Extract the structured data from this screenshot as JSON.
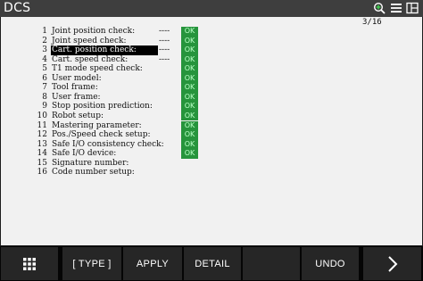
{
  "window": {
    "title": "DCS",
    "icons": [
      "zoom-icon",
      "menu-icon",
      "split-screen-icon"
    ]
  },
  "page_indicator": "3/16",
  "colors": {
    "ok_background": "#26943c",
    "ok_text": "#b9ffc6",
    "panel": "#f1f1f1",
    "titlebar": "#3e3e3e",
    "fkey": "#262626"
  },
  "rows": [
    {
      "num": "1",
      "label": "Joint position check:",
      "dashes": "----",
      "status": "OK",
      "selected": false
    },
    {
      "num": "2",
      "label": "Joint speed check:",
      "dashes": "----",
      "status": "OK",
      "selected": false
    },
    {
      "num": "3",
      "label": "Cart. position check:",
      "dashes": "----",
      "status": "OK",
      "selected": true
    },
    {
      "num": "4",
      "label": "Cart. speed check:",
      "dashes": "----",
      "status": "OK",
      "selected": false
    },
    {
      "num": "5",
      "label": "T1 mode speed check:",
      "dashes": "",
      "status": "OK",
      "selected": false
    },
    {
      "num": "6",
      "label": "User model:",
      "dashes": "",
      "status": "OK",
      "selected": false
    },
    {
      "num": "7",
      "label": "Tool frame:",
      "dashes": "",
      "status": "OK",
      "selected": false
    },
    {
      "num": "8",
      "label": "User frame:",
      "dashes": "",
      "status": "OK",
      "selected": false
    },
    {
      "num": "9",
      "label": "Stop position prediction:",
      "dashes": "",
      "status": "OK",
      "selected": false
    },
    {
      "num": "10",
      "label": "Robot setup:",
      "dashes": "",
      "status": "OK",
      "selected": false
    },
    {
      "num": "11",
      "label": "Mastering parameter:",
      "dashes": "",
      "status": "OK",
      "selected": false
    },
    {
      "num": "12",
      "label": "Pos./Speed check setup:",
      "dashes": "",
      "status": "OK",
      "selected": false
    },
    {
      "num": "13",
      "label": "Safe I/O consistency check:",
      "dashes": "",
      "status": "OK",
      "selected": false
    },
    {
      "num": "14",
      "label": "Safe I/O device:",
      "dashes": "",
      "status": "OK",
      "selected": false
    },
    {
      "num": "15",
      "label": "Signature number:",
      "dashes": "",
      "status": "",
      "selected": false
    },
    {
      "num": "16",
      "label": "Code number setup:",
      "dashes": "",
      "status": "",
      "selected": false
    }
  ],
  "function_keys": [
    {
      "name": "grid-menu-key",
      "label": "",
      "icon": "grid-icon"
    },
    {
      "name": "type-key",
      "label": "[ TYPE ]"
    },
    {
      "name": "apply-key",
      "label": "APPLY"
    },
    {
      "name": "detail-key",
      "label": "DETAIL"
    },
    {
      "name": "f4-key",
      "label": ""
    },
    {
      "name": "undo-key",
      "label": "UNDO"
    },
    {
      "name": "next-key",
      "label": "",
      "icon": "chevron-right-icon"
    }
  ]
}
